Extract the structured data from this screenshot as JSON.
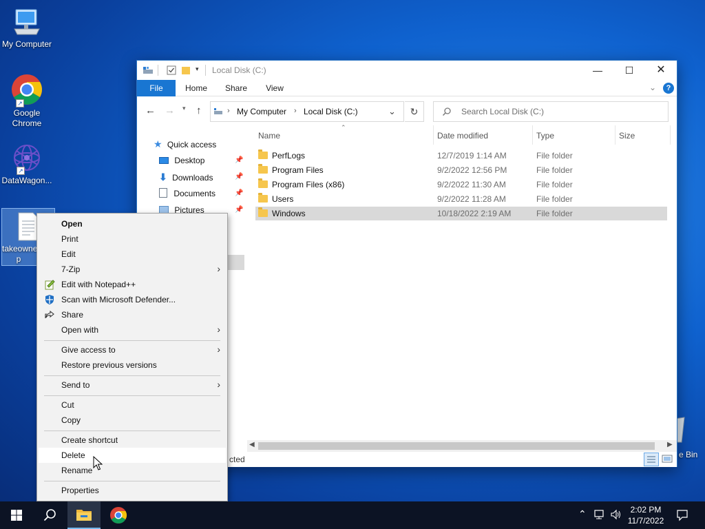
{
  "desktop": {
    "icons": [
      {
        "label": "My Computer"
      },
      {
        "label": "Google Chrome"
      },
      {
        "label": "DataWagon..."
      },
      {
        "label": "takeowne p"
      },
      {
        "label": "e Bin"
      }
    ]
  },
  "explorer": {
    "title": "Local Disk (C:)",
    "tabs": {
      "file": "File",
      "home": "Home",
      "share": "Share",
      "view": "View"
    },
    "breadcrumb": [
      "My Computer",
      "Local Disk (C:)"
    ],
    "search_placeholder": "Search Local Disk (C:)",
    "nav": {
      "quick_access": "Quick access",
      "items": [
        {
          "label": "Desktop"
        },
        {
          "label": "Downloads"
        },
        {
          "label": "Documents"
        },
        {
          "label": "Pictures"
        }
      ]
    },
    "columns": {
      "name": "Name",
      "date": "Date modified",
      "type": "Type",
      "size": "Size"
    },
    "rows": [
      {
        "name": "PerfLogs",
        "date": "12/7/2019 1:14 AM",
        "type": "File folder"
      },
      {
        "name": "Program Files",
        "date": "9/2/2022 12:56 PM",
        "type": "File folder"
      },
      {
        "name": "Program Files (x86)",
        "date": "9/2/2022 11:30 AM",
        "type": "File folder"
      },
      {
        "name": "Users",
        "date": "9/2/2022 11:28 AM",
        "type": "File folder"
      },
      {
        "name": "Windows",
        "date": "10/18/2022 2:19 AM",
        "type": "File folder"
      }
    ],
    "status_text": "cted"
  },
  "context_menu": {
    "items": {
      "open": "Open",
      "print": "Print",
      "edit": "Edit",
      "sevenzip": "7-Zip",
      "notepadpp": "Edit with Notepad++",
      "defender": "Scan with Microsoft Defender...",
      "share": "Share",
      "open_with": "Open with",
      "give_access": "Give access to",
      "restore": "Restore previous versions",
      "send_to": "Send to",
      "cut": "Cut",
      "copy": "Copy",
      "create_shortcut": "Create shortcut",
      "delete": "Delete",
      "rename": "Rename",
      "properties": "Properties"
    }
  },
  "taskbar": {
    "time": "2:02 PM",
    "date": "11/7/2022"
  },
  "colors": {
    "accent": "#1976d2",
    "selection": "#d9d9d9",
    "taskbar": "#0c1324"
  }
}
